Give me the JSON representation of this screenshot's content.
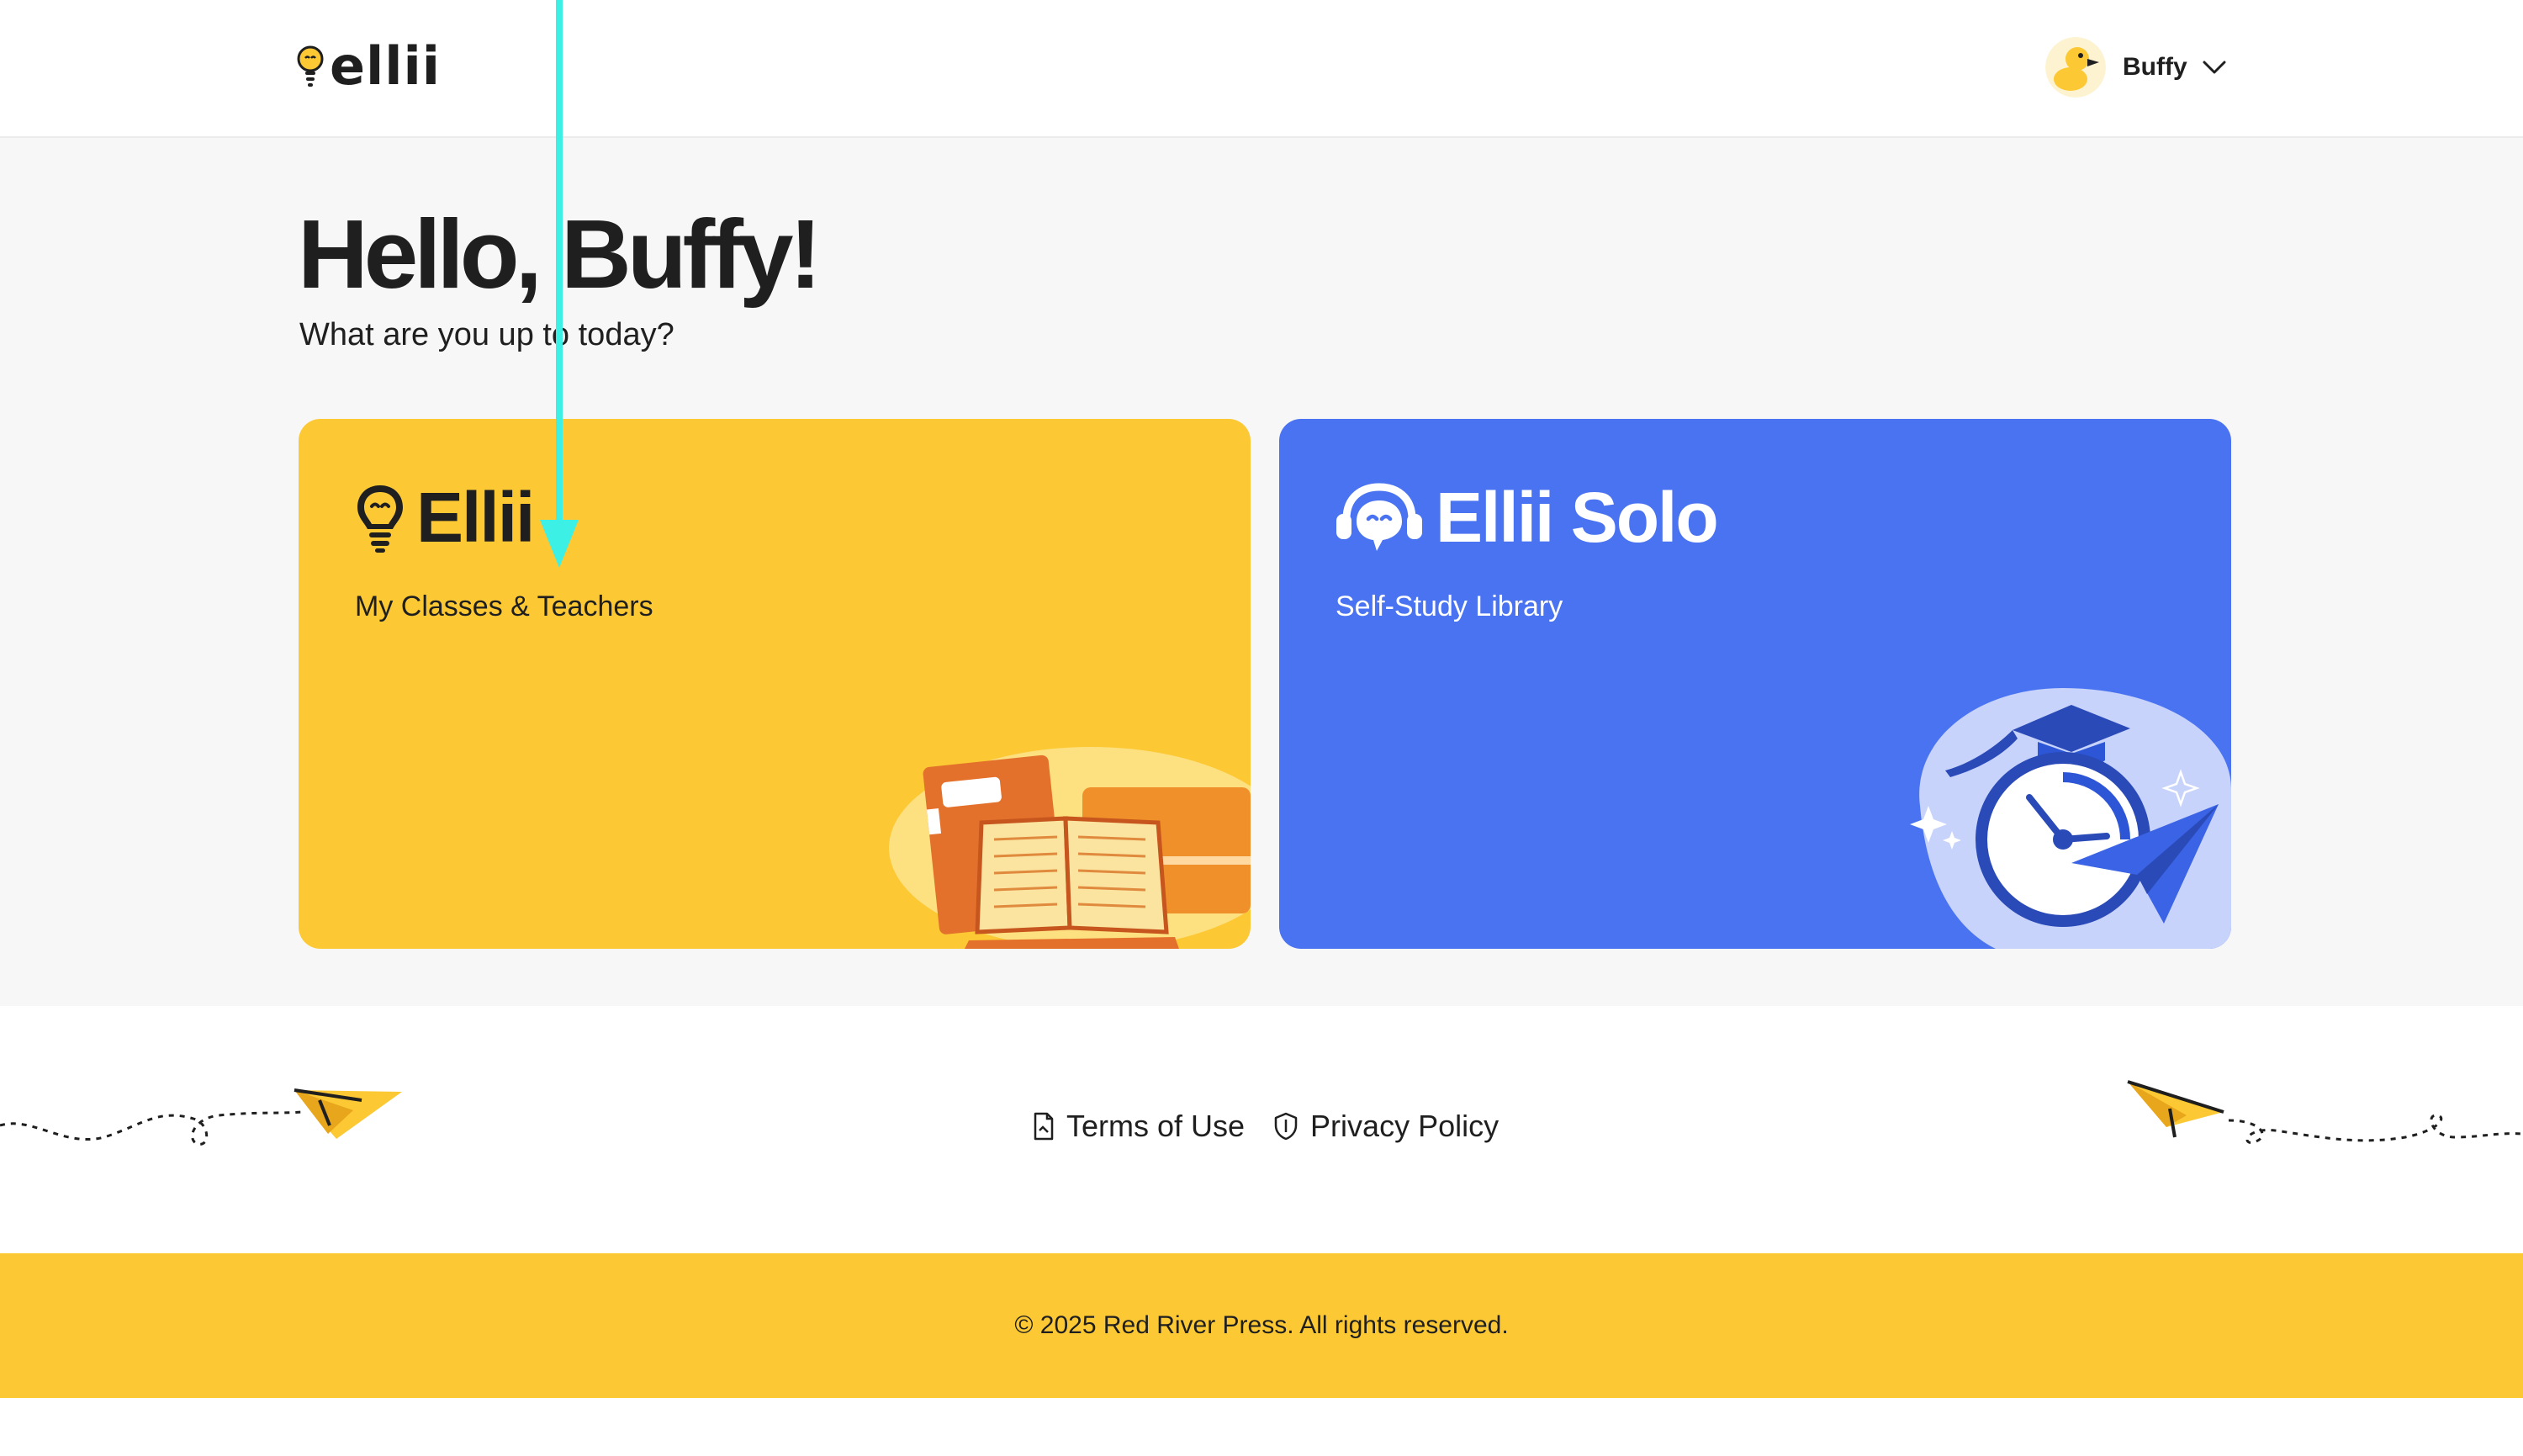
{
  "header": {
    "logo_text": "ellii",
    "user_name": "Buffy"
  },
  "greeting": {
    "title": "Hello, Buffy!",
    "subtitle": "What are you up to today?"
  },
  "cards": [
    {
      "brand": "Ellii",
      "subtitle": "My Classes & Teachers",
      "color": "#fcc935"
    },
    {
      "brand": "Ellii Solo",
      "subtitle": "Self-Study Library",
      "color": "#4a73f2"
    }
  ],
  "footer": {
    "links": [
      {
        "label": "Terms of Use",
        "icon": "document-icon"
      },
      {
        "label": "Privacy Policy",
        "icon": "shield-icon"
      }
    ],
    "copyright": "© 2025 Red River Press. All rights reserved."
  },
  "colors": {
    "brand_yellow": "#fcc935",
    "solo_blue": "#4a73f2",
    "annotation_arrow": "#3df0e6"
  }
}
